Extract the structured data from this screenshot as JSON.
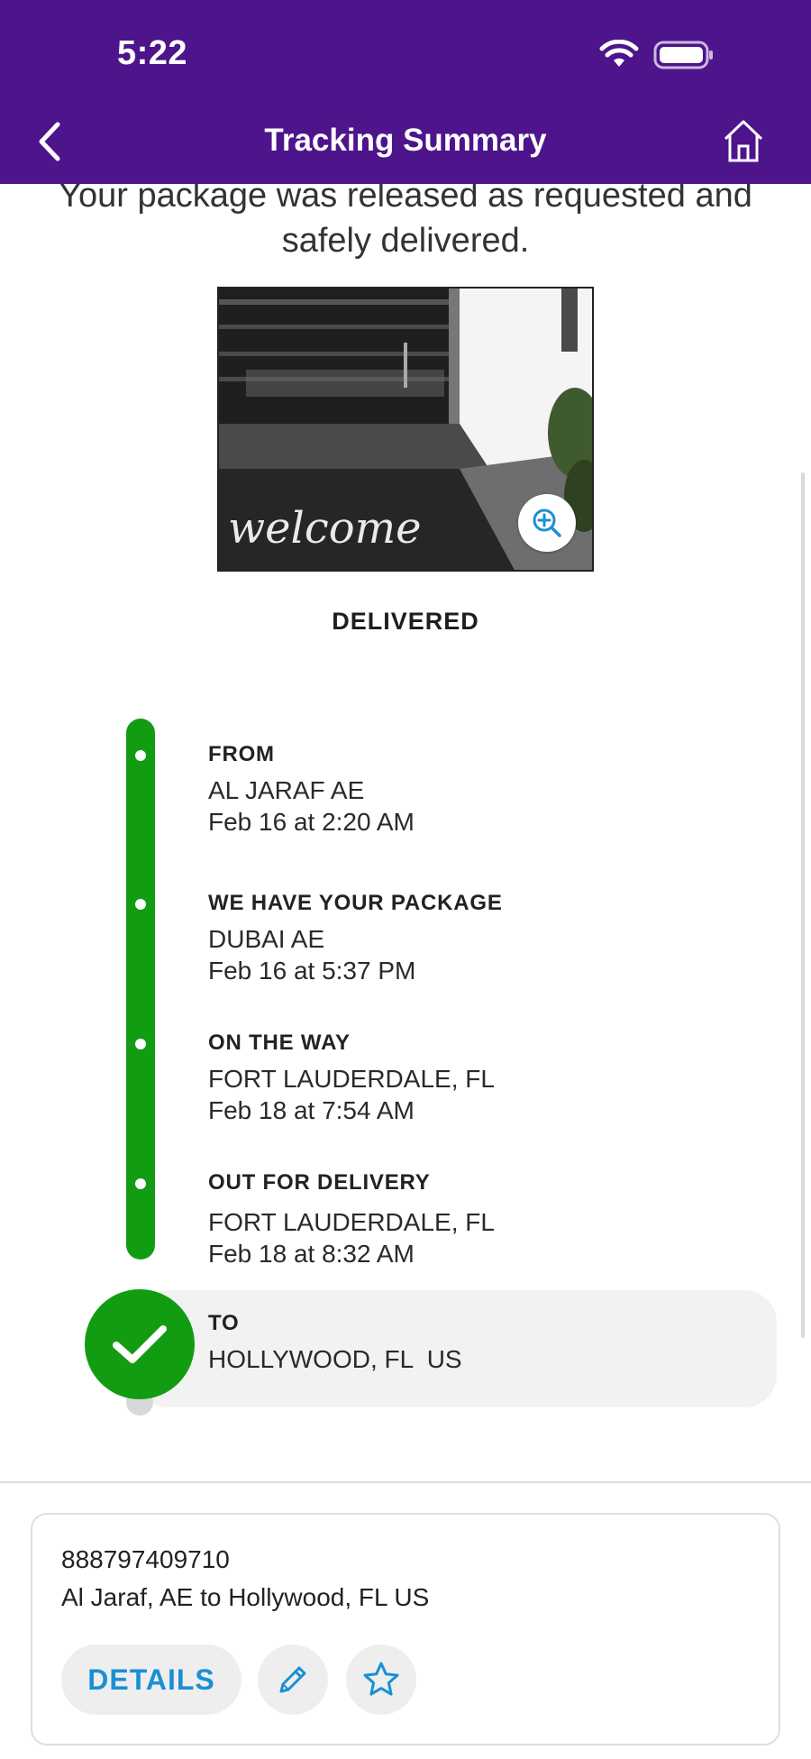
{
  "status_bar": {
    "time": "5:22"
  },
  "header": {
    "title": "Tracking Summary"
  },
  "message": "Your package was released as requested and safely delivered.",
  "photo": {
    "mat_text": "welcome"
  },
  "status": "DELIVERED",
  "timeline": [
    {
      "title": "FROM",
      "location": "AL JARAF AE",
      "time": "Feb 16 at 2:20 AM"
    },
    {
      "title": "WE HAVE YOUR PACKAGE",
      "location": "DUBAI AE",
      "time": "Feb 16 at 5:37 PM"
    },
    {
      "title": "ON THE WAY",
      "location": "FORT LAUDERDALE, FL",
      "time": "Feb 18 at 7:54 AM"
    },
    {
      "title": "OUT FOR DELIVERY",
      "location": "FORT LAUDERDALE, FL",
      "time": "Feb 18 at 8:32 AM"
    }
  ],
  "destination": {
    "title": "TO",
    "location": "HOLLYWOOD, FL  US"
  },
  "card": {
    "tracking_number": "888797409710",
    "route": "Al Jaraf, AE to Hollywood, FL US",
    "details_label": "DETAILS"
  },
  "colors": {
    "header": "#4d148c",
    "track_green": "#129c12",
    "link_blue": "#1a90d4"
  },
  "icons": [
    "back-icon",
    "home-icon",
    "wifi-icon",
    "battery-icon",
    "zoom-in-icon",
    "checkmark-icon",
    "pencil-icon",
    "star-icon"
  ]
}
